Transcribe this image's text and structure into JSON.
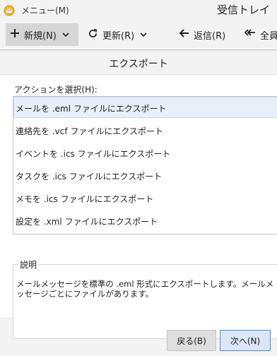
{
  "menu": {
    "label": "メニュー(M)",
    "window_title": "受信トレイ"
  },
  "toolbar": {
    "new_label": "新規(N)",
    "update_label": "更新(R)",
    "reply_label": "返信(R)",
    "reply_all_label": "全員"
  },
  "dialog": {
    "title": "エクスポート",
    "action_label": "アクションを選択(H):",
    "actions": [
      {
        "label": "メールを .eml ファイルにエクスポート",
        "selected": true
      },
      {
        "label": "連絡先を .vcf ファイルにエクスポート",
        "selected": false
      },
      {
        "label": "イベントを .ics ファイルにエクスポート",
        "selected": false
      },
      {
        "label": "タスクを .ics ファイルにエクスポート",
        "selected": false
      },
      {
        "label": "メモを .ics ファイルにエクスポート",
        "selected": false
      },
      {
        "label": "設定を .xml ファイルにエクスポート",
        "selected": false
      }
    ],
    "description_label": "説明",
    "description_text": "メールメッセージを標準の .eml 形式にエクスポートします。メールメッセージごとにファイルがあります。",
    "back_button": "戻る(B)",
    "next_button": "次へ(N)"
  },
  "colors": {
    "selected_row": "#e8eff9",
    "next_button_border": "#4a8cd8"
  },
  "icons": {
    "app": "envelope-icon",
    "new": "plus-icon",
    "update": "refresh-icon",
    "reply": "reply-arrow-icon",
    "reply_all": "reply-all-icon"
  }
}
